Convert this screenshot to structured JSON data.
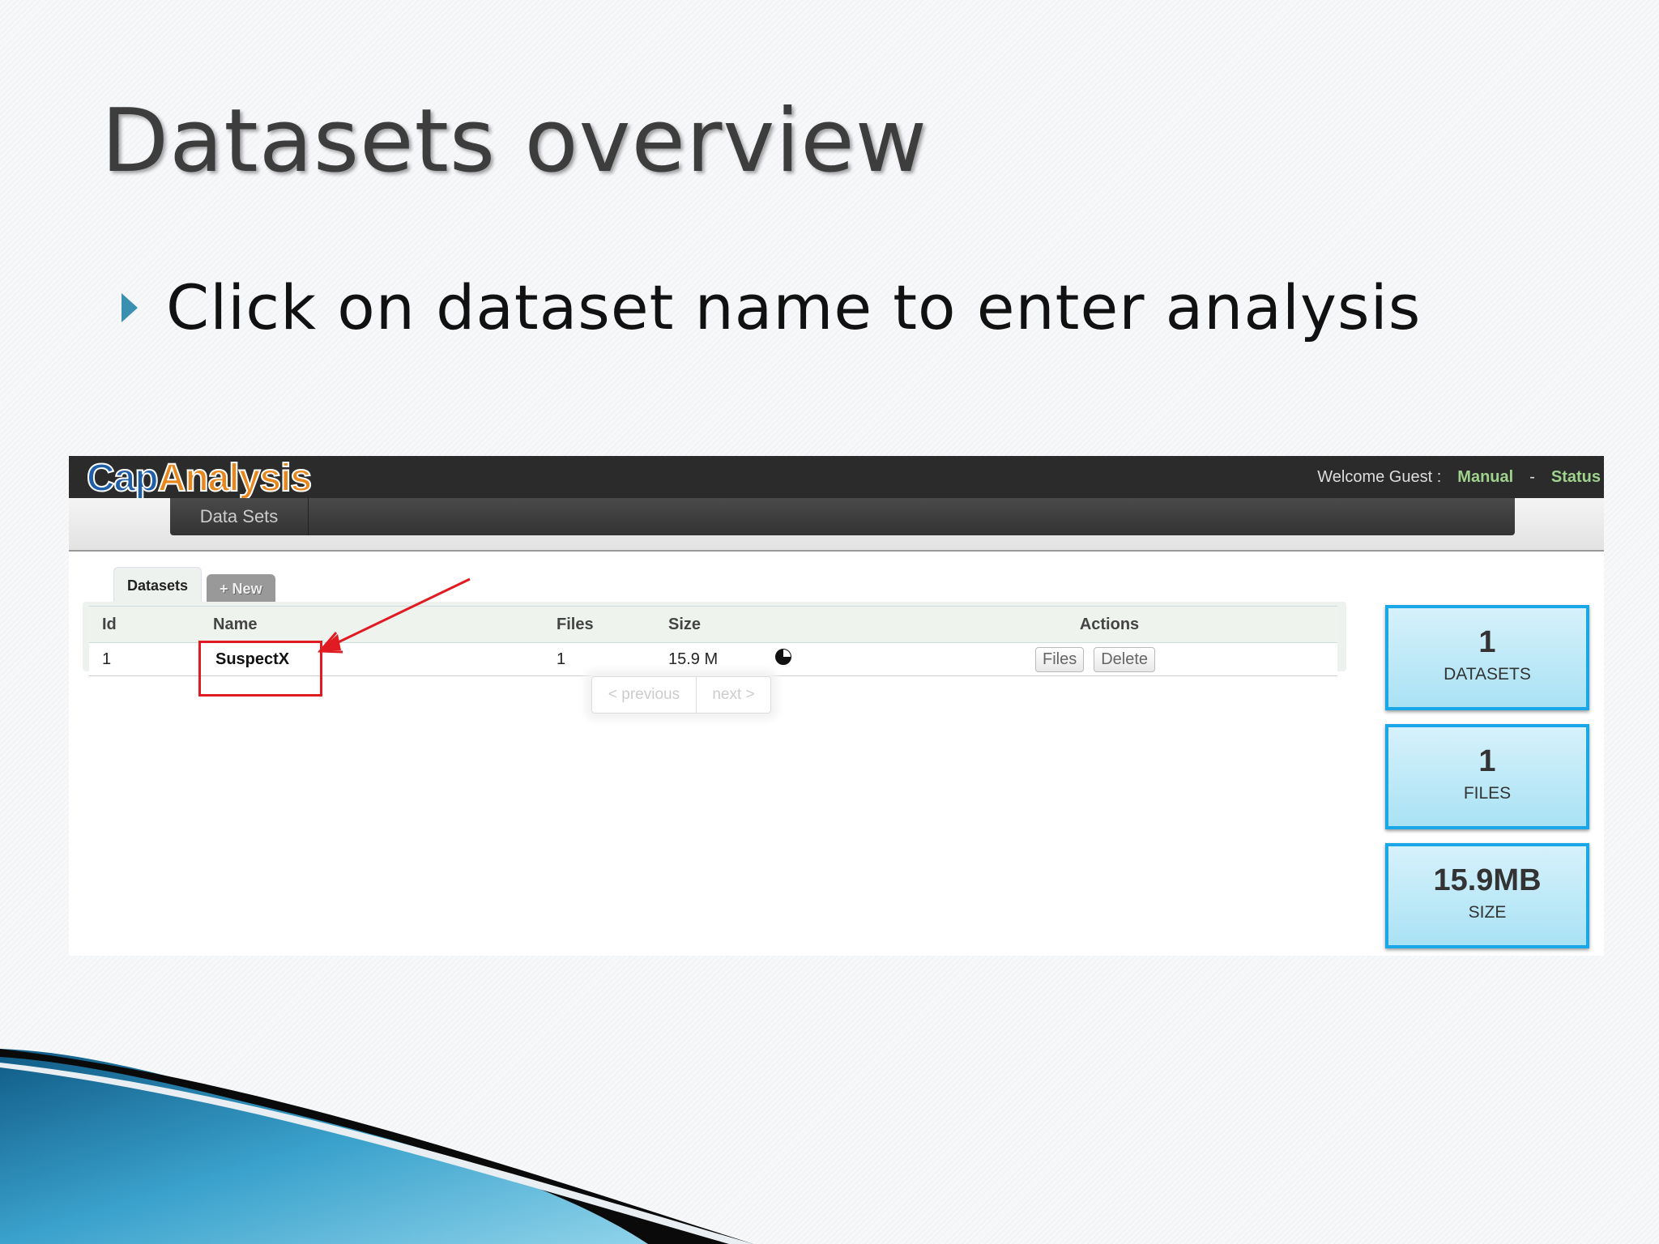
{
  "slide": {
    "title": "Datasets overview",
    "bullet": "Click on dataset name to enter analysis"
  },
  "app": {
    "logo_part1": "Cap",
    "logo_part2": "Analysis",
    "welcome": "Welcome Guest :",
    "manual_link": "Manual",
    "separator": "-",
    "status_link": "Status",
    "nav_item": "Data Sets"
  },
  "tabs": {
    "datasets": "Datasets",
    "new": "+ New"
  },
  "table": {
    "headers": [
      "Id",
      "Name",
      "Files",
      "Size",
      "Actions"
    ],
    "rows": [
      {
        "id": "1",
        "name": "SuspectX",
        "files": "1",
        "size": "15.9 M",
        "btn_files": "Files",
        "btn_delete": "Delete"
      }
    ]
  },
  "pager": {
    "previous": "< previous",
    "next": "next >"
  },
  "stats": [
    {
      "value": "1",
      "label": "DATASETS"
    },
    {
      "value": "1",
      "label": "FILES"
    },
    {
      "value": "15.9MB",
      "label": "SIZE"
    }
  ],
  "colors": {
    "accent_cyan": "#19a7e8",
    "highlight_red": "#e01b22",
    "topbar": "#2b2b2b",
    "link_green": "#9fd28c"
  },
  "icons": {
    "pie": "pie-chart-icon",
    "bullet": "triangle-bullet-icon",
    "arrow": "red-arrow-annotation"
  }
}
